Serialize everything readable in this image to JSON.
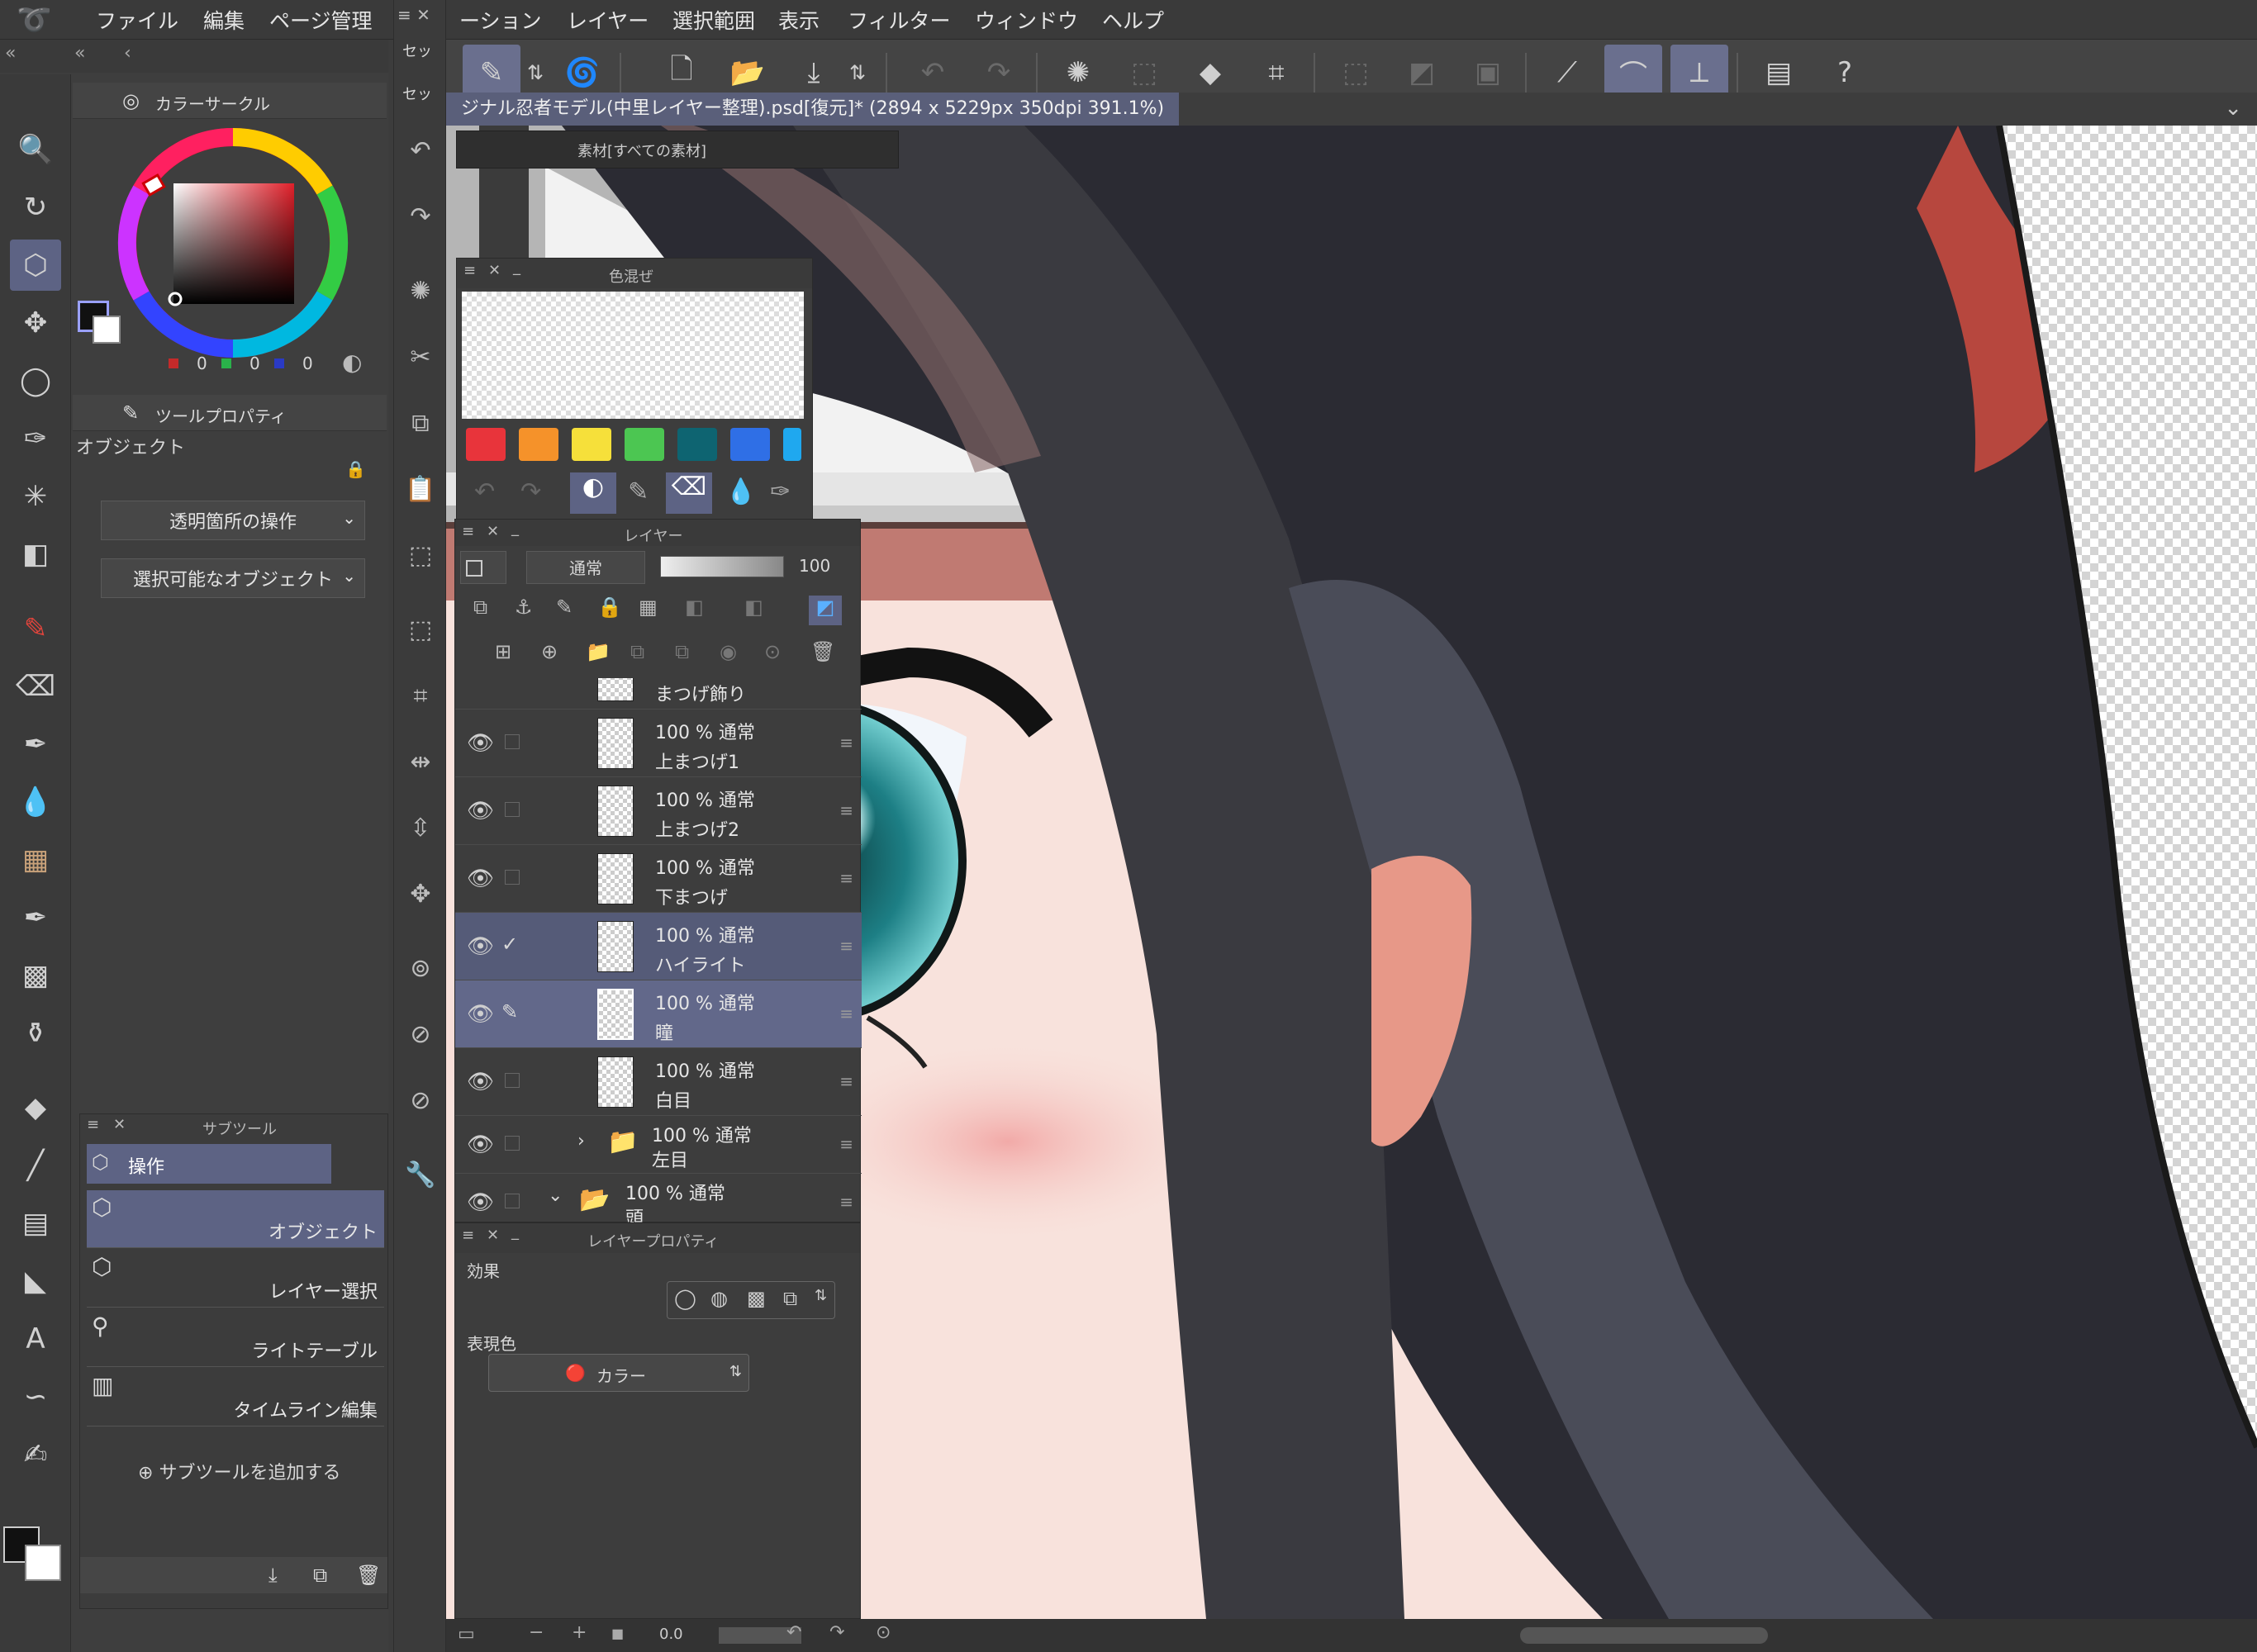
{
  "menu": {
    "items": [
      "ファイル",
      "編集",
      "ページ管理",
      "ーション",
      "レイヤー",
      "選択範囲",
      "表示",
      "フィルター",
      "ウィンドウ",
      "ヘルプ"
    ]
  },
  "document": {
    "tab_title": "ジナル忍者モデル(中里レイヤー整理).psd[復元]* (2894 x 5229px 350dpi 391.1%)"
  },
  "material_panel": {
    "title": "素材[すべての素材]"
  },
  "set_tabs": [
    "セッ",
    "セッ"
  ],
  "color_circle": {
    "title": "カラーサークル",
    "r": "0",
    "g": "0",
    "b": "0",
    "main_color": "#111111",
    "sub_color": "#ffffff"
  },
  "tool_property": {
    "title": "ツールプロパティ",
    "subtitle": "オブジェクト",
    "dropdown1": "透明箇所の操作",
    "dropdown2": "選択可能なオブジェクト"
  },
  "subtool": {
    "title": "サブツール",
    "group": "操作",
    "items": [
      "オブジェクト",
      "レイヤー選択",
      "ライトテーブル",
      "タイムライン編集"
    ],
    "add_label": "サブツールを追加する"
  },
  "color_mix": {
    "title": "色混ぜ",
    "swatches": [
      "#e8343b",
      "#f5922a",
      "#f6e03a",
      "#4cc652",
      "#0e6471",
      "#2f6fe6",
      "#1fa8ef"
    ]
  },
  "layer_panel": {
    "title": "レイヤー",
    "blend_mode": "通常",
    "opacity": "100",
    "layers": [
      {
        "pct": "",
        "name": "まつげ飾り",
        "state": ""
      },
      {
        "pct": "100 % 通常",
        "name": "上まつげ1",
        "state": ""
      },
      {
        "pct": "100 % 通常",
        "name": "上まつげ2",
        "state": ""
      },
      {
        "pct": "100 % 通常",
        "name": "下まつげ",
        "state": ""
      },
      {
        "pct": "100 % 通常",
        "name": "ハイライト",
        "state": "sel"
      },
      {
        "pct": "100 % 通常",
        "name": "瞳",
        "state": "cur"
      },
      {
        "pct": "100 % 通常",
        "name": "白目",
        "state": ""
      },
      {
        "pct": "100 % 通常",
        "name": "左目",
        "state": "folder"
      },
      {
        "pct": "100 % 通常",
        "name": "頭",
        "state": "folder-open"
      }
    ]
  },
  "layer_property": {
    "title": "レイヤープロパティ",
    "effect_label": "効果",
    "expression_label": "表現色",
    "expression_value": "カラー"
  },
  "status": {
    "zoom_value": "0.0"
  }
}
